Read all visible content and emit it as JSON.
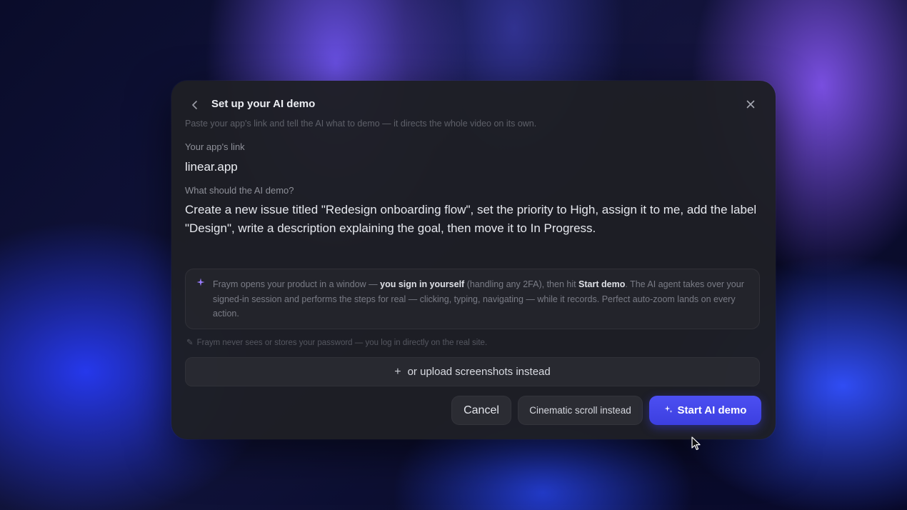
{
  "dialog": {
    "title": "Set up your AI demo",
    "subtitle": "Paste your app's link and tell the AI what to demo — it directs the whole video on its own.",
    "back_icon": "chevron-left-icon",
    "close_icon": "close-icon"
  },
  "app_link": {
    "label": "Your app's link",
    "value": "linear.app"
  },
  "demo_prompt": {
    "label": "What should the AI demo?",
    "value": "Create a new issue titled \"Redesign onboarding flow\", set the priority to High, assign it to me, add the label \"Design\", write a description explaining the goal, then move it to In Progress."
  },
  "info": {
    "icon": "sparkle-icon",
    "part1": "Fraym opens your product in a window — ",
    "bold1": "you sign in yourself",
    "part2": " (handling any 2FA), then hit ",
    "bold2": "Start demo",
    "part3": ". The AI agent takes over your signed-in session and performs the steps for real — clicking, typing, navigating — while it records. Perfect auto-zoom lands on every action."
  },
  "privacy": {
    "icon": "lock-icon",
    "text": "Fraym never sees or stores your password — you log in directly on the real site."
  },
  "upload": {
    "icon": "plus-icon",
    "label": "or upload screenshots instead"
  },
  "actions": {
    "cancel": "Cancel",
    "cinematic": "Cinematic scroll instead",
    "start": "Start AI demo",
    "start_icon": "sparkle-icon"
  },
  "colors": {
    "accent": "#4245e8",
    "dialog_bg": "#1e1f25"
  }
}
